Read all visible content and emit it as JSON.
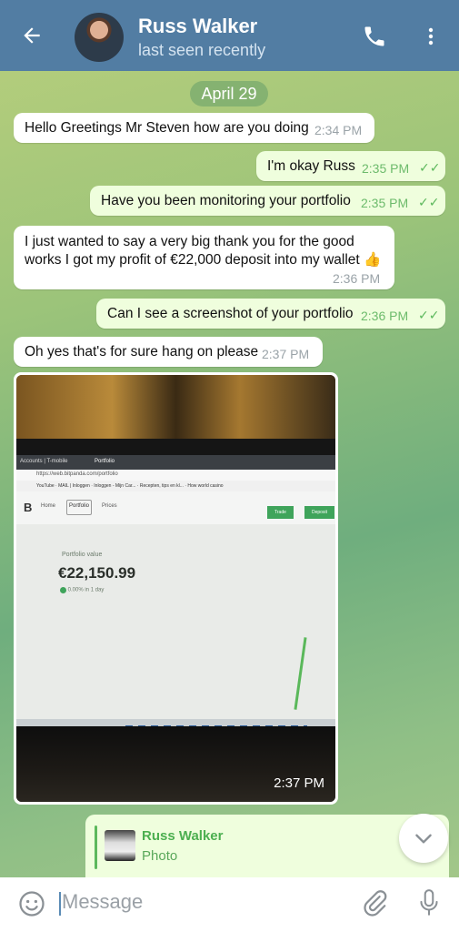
{
  "header": {
    "contact_name": "Russ Walker",
    "status": "last seen recently"
  },
  "chat": {
    "date": "April 29",
    "messages": [
      {
        "direction": "in",
        "text": "Hello Greetings Mr Steven how are you doing",
        "time": "2:34 PM"
      },
      {
        "direction": "out",
        "text": "I'm okay Russ",
        "time": "2:35 PM",
        "read": true
      },
      {
        "direction": "out",
        "text": "Have you been monitoring your portfolio",
        "time": "2:35 PM",
        "read": true
      },
      {
        "direction": "in",
        "text_line1": "I just wanted to say a very big thank you for the good",
        "text_line2": "works I got my profit of €22,000 deposit into my wallet 👍",
        "time": "2:36 PM"
      },
      {
        "direction": "out",
        "text": "Can I see a screenshot of your portfolio",
        "time": "2:36 PM",
        "read": true
      },
      {
        "direction": "in",
        "text": "Oh yes that's for sure hang on please",
        "time": "2:37 PM"
      }
    ],
    "photo": {
      "time": "2:37 PM",
      "screen": {
        "tab1": "Accounts | T-mobile",
        "tab2": "Portfolio",
        "url": "https://web.bitpanda.com/portfolio",
        "bookmarks": "YouTube · MAIL | Inloggen · Inloggen - Mijn Car... · Recepten, tips en kl... · How world casino",
        "nav_home": "Home",
        "nav_portfolio": "Portfolio",
        "nav_prices": "Prices",
        "btn_trade": "Trade",
        "btn_deposit": "Deposit",
        "pv_label": "Portfolio value",
        "pv_value": "€22,150.99",
        "pv_change": "0.00%  in 1 day"
      }
    },
    "reply": {
      "name": "Russ Walker",
      "subtitle": "Photo"
    }
  },
  "input": {
    "placeholder": "Message"
  },
  "colors": {
    "header_bg": "#527da3",
    "outgoing_bubble": "#effedd",
    "incoming_bubble": "#ffffff",
    "check_color": "#5cb85c"
  },
  "icons": [
    "back-arrow-icon",
    "phone-icon",
    "more-vert-icon",
    "emoji-icon",
    "attach-icon",
    "mic-icon",
    "chevron-down-icon",
    "double-check-icon"
  ]
}
